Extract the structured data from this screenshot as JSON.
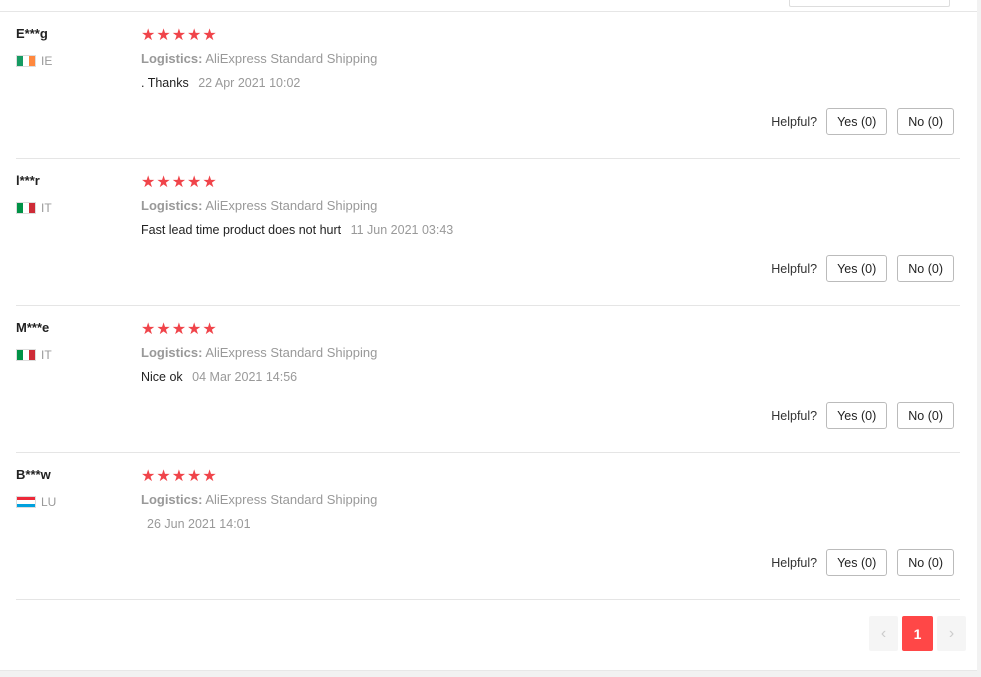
{
  "reviews": [
    {
      "user": "E***g",
      "country": "IE",
      "flag": [
        "#169b62",
        "#ffffff",
        "#ff883e"
      ],
      "flag_orientation": "vertical",
      "stars": "★★★★★",
      "logistics_label": "Logistics:",
      "logistics_value": "AliExpress Standard Shipping",
      "text": ". Thanks",
      "date": "22 Apr 2021 10:02",
      "helpful_label": "Helpful?",
      "yes": "Yes (0)",
      "no": "No (0)"
    },
    {
      "user": "l***r",
      "country": "IT",
      "flag": [
        "#009246",
        "#ffffff",
        "#ce2b37"
      ],
      "flag_orientation": "vertical",
      "stars": "★★★★★",
      "logistics_label": "Logistics:",
      "logistics_value": "AliExpress Standard Shipping",
      "text": "Fast lead time product does not hurt",
      "date": "11 Jun 2021 03:43",
      "helpful_label": "Helpful?",
      "yes": "Yes (0)",
      "no": "No (0)"
    },
    {
      "user": "M***e",
      "country": "IT",
      "flag": [
        "#009246",
        "#ffffff",
        "#ce2b37"
      ],
      "flag_orientation": "vertical",
      "stars": "★★★★★",
      "logistics_label": "Logistics:",
      "logistics_value": "AliExpress Standard Shipping",
      "text": "Nice ok",
      "date": "04 Mar 2021 14:56",
      "helpful_label": "Helpful?",
      "yes": "Yes (0)",
      "no": "No (0)"
    },
    {
      "user": "B***w",
      "country": "LU",
      "flag": [
        "#ed2939",
        "#ffffff",
        "#00a1de"
      ],
      "flag_orientation": "horizontal",
      "stars": "★★★★★",
      "logistics_label": "Logistics:",
      "logistics_value": "AliExpress Standard Shipping",
      "text": "",
      "date": "26 Jun 2021 14:01",
      "helpful_label": "Helpful?",
      "yes": "Yes (0)",
      "no": "No (0)"
    }
  ],
  "pagination": {
    "prev": "‹",
    "current": "1",
    "next": "›"
  },
  "colors": {
    "star": "#f0444a",
    "active_page": "#ff4747"
  }
}
